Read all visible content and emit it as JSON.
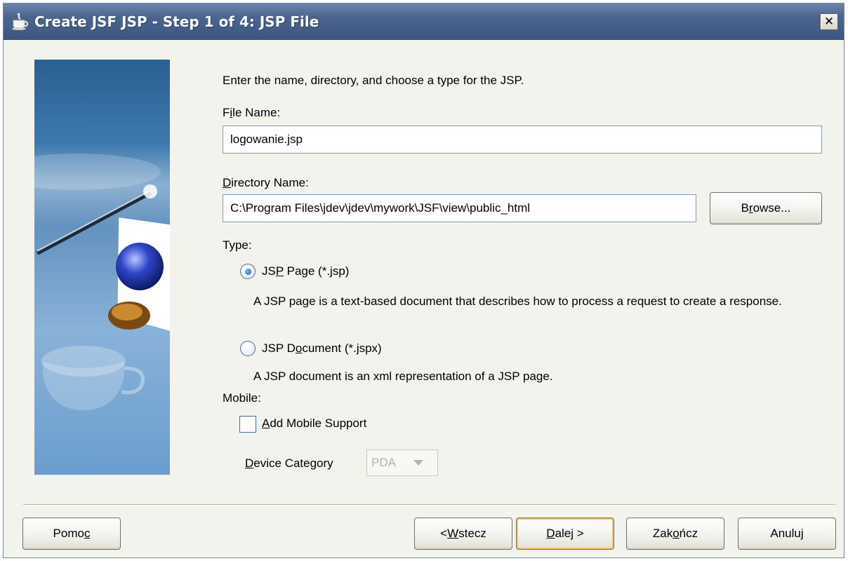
{
  "window": {
    "title": "Create JSF JSP - Step 1 of 4: JSP File",
    "close_label": "✕"
  },
  "form": {
    "intro": "Enter the name, directory, and choose a type for the JSP.",
    "file_name_label": {
      "pre": "F",
      "u": "i",
      "post": "le Name:"
    },
    "file_name_value": "logowanie.jsp",
    "directory_label": {
      "pre": "",
      "u": "D",
      "post": "irectory Name:"
    },
    "directory_value": "C:\\Program Files\\jdev\\jdev\\mywork\\JSF\\view\\public_html",
    "browse_label": {
      "pre": "B",
      "u": "r",
      "post": "owse..."
    },
    "type_label": "Type:",
    "type_options": [
      {
        "label": {
          "pre": "JS",
          "u": "P",
          "post": " Page (*.jsp)"
        },
        "checked": true,
        "description": "A JSP page is a text-based document that describes how to process a request to create a response."
      },
      {
        "label": {
          "pre": "JSP D",
          "u": "o",
          "post": "cument (*.jspx)"
        },
        "checked": false,
        "description": "A JSP document is an xml representation of a JSP page."
      }
    ],
    "mobile_label": "Mobile:",
    "mobile_checkbox": {
      "pre": "",
      "u": "A",
      "post": "dd Mobile Support",
      "checked": false
    },
    "device_category_label": {
      "pre": "",
      "u": "D",
      "post": "evice Category"
    },
    "device_category_value": "PDA"
  },
  "buttons": {
    "help": {
      "pre": "Pomo",
      "u": "c",
      "post": ""
    },
    "back": {
      "pre": "< ",
      "u": "W",
      "post": "stecz"
    },
    "next": {
      "pre": "",
      "u": "D",
      "post": "alej >"
    },
    "finish": {
      "pre": "Zak",
      "u": "o",
      "post": "ńcz"
    },
    "cancel": {
      "pre": "Anuluj",
      "u": "",
      "post": ""
    }
  },
  "colors": {
    "title_bar": "#3b5580",
    "dialog_bg": "#f3f3ee",
    "default_button_ring": "#f0c36a"
  }
}
